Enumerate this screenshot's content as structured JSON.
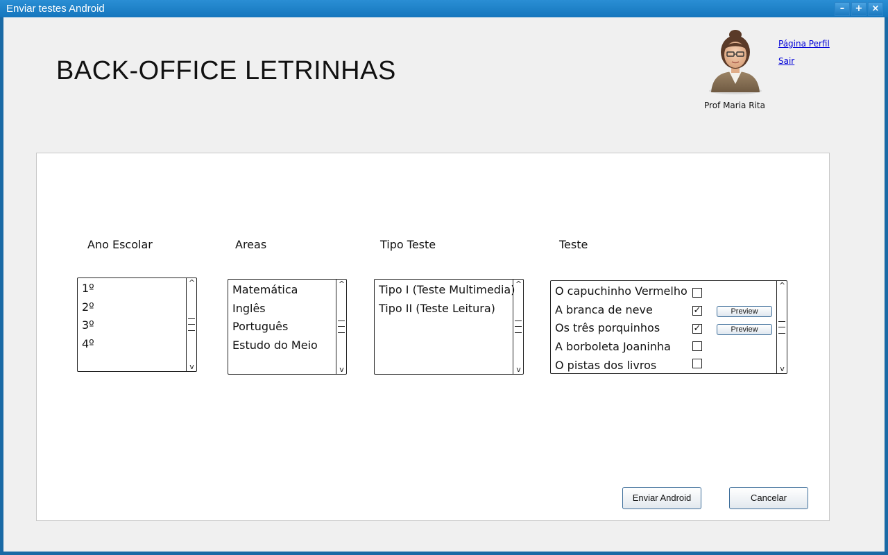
{
  "window": {
    "title": "Enviar testes Android",
    "controls": {
      "minimize": "–",
      "maximize": "+",
      "close": "×"
    }
  },
  "header": {
    "app_title": "BACK-OFFICE LETRINHAS",
    "user_name": "Prof Maria Rita",
    "links": {
      "profile": "Página Perfil",
      "logout": "Sair"
    }
  },
  "columns": {
    "ano_escolar": {
      "label": "Ano Escolar",
      "items": [
        "1º",
        "2º",
        "3º",
        "4º"
      ]
    },
    "areas": {
      "label": "Areas",
      "items": [
        "Matemática",
        "Inglês",
        "Português",
        "Estudo do Meio"
      ]
    },
    "tipo_teste": {
      "label": "Tipo Teste",
      "items": [
        "Tipo I (Teste Multimedia)",
        "Tipo II (Teste Leitura)"
      ]
    },
    "teste": {
      "label": "Teste",
      "items": [
        {
          "name": "O capuchinho Vermelho",
          "checked": false,
          "preview": ""
        },
        {
          "name": "A branca de neve",
          "checked": true,
          "preview": "Preview"
        },
        {
          "name": "Os três porquinhos",
          "checked": true,
          "preview": "Preview"
        },
        {
          "name": "A borboleta Joaninha",
          "checked": false,
          "preview": ""
        },
        {
          "name": "O pistas dos livros",
          "checked": false,
          "preview": ""
        }
      ]
    }
  },
  "actions": {
    "send": "Enviar Android",
    "cancel": "Cancelar"
  },
  "icons": {
    "scroll_up": "^",
    "scroll_down": "v",
    "check_mark": "✓"
  },
  "colors": {
    "title_bar": "#1576bd",
    "link": "#0000d8",
    "button_border": "#3b6c99"
  }
}
